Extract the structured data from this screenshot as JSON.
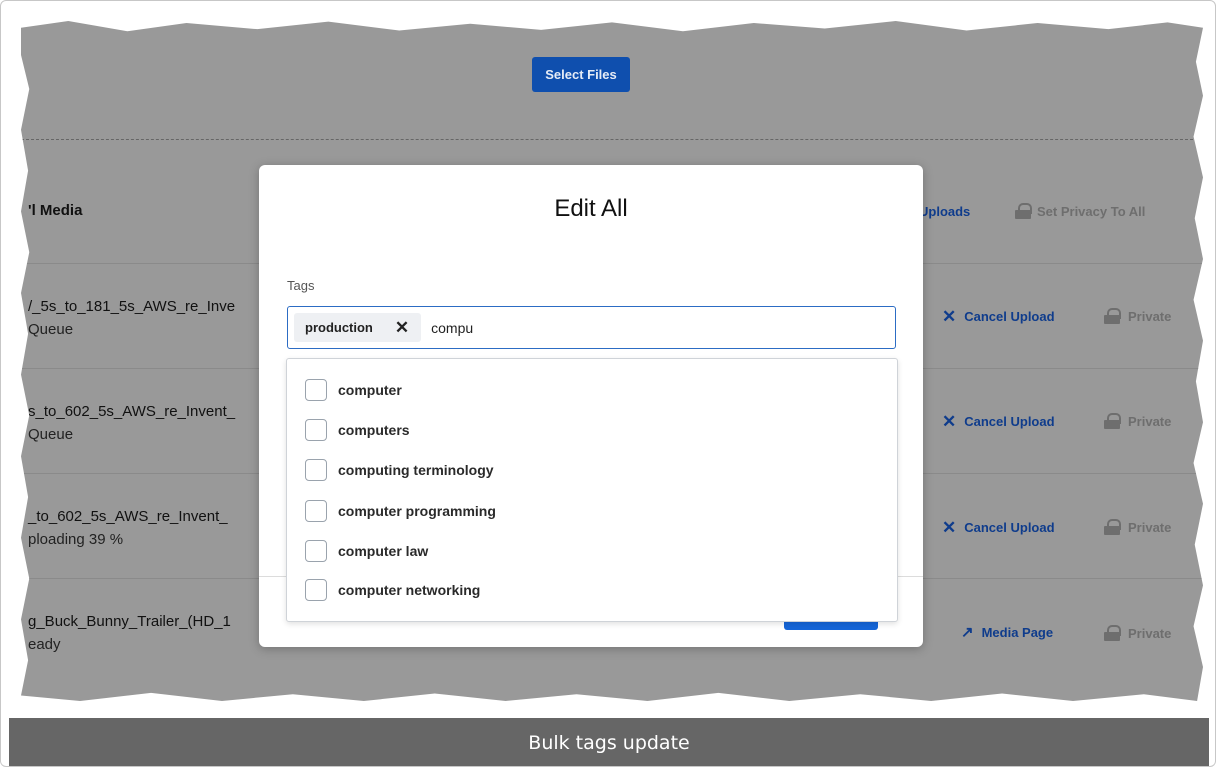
{
  "upload": {
    "select_files": "Select Files"
  },
  "header": {
    "title": "'l Media",
    "uploads": "Uploads",
    "set_privacy": "Set Privacy To All"
  },
  "rows": [
    {
      "name": "/_5s_to_181_5s_AWS_re_Inve",
      "status": "Queue",
      "action": "Cancel Upload",
      "privacy": "Private"
    },
    {
      "name": "s_to_602_5s_AWS_re_Invent_",
      "status": "Queue",
      "action": "Cancel Upload",
      "privacy": "Private"
    },
    {
      "name": "_to_602_5s_AWS_re_Invent_",
      "status": "ploading 39 %",
      "action": "Cancel Upload",
      "privacy": "Private"
    },
    {
      "name": "g_Buck_Bunny_Trailer_(HD_1",
      "status": "eady",
      "action": "Media Page",
      "privacy": "Private"
    }
  ],
  "modal": {
    "title": "Edit All",
    "tags_label": "Tags",
    "selected_tags": [
      "production"
    ],
    "input_value": "compu",
    "suggestions": [
      "computer",
      "computers",
      "computing terminology",
      "computer programming",
      "computer law",
      "computer networking"
    ]
  },
  "caption": "Bulk tags update",
  "colors": {
    "overlay": "#999999",
    "primary": "#0f4fae",
    "link": "#0f3c8c",
    "caption_bg": "#666666"
  },
  "icons": {
    "cancel": "x-icon",
    "privacy": "lock-icon",
    "media_page": "external-link-icon",
    "remove_tag": "close-icon"
  }
}
